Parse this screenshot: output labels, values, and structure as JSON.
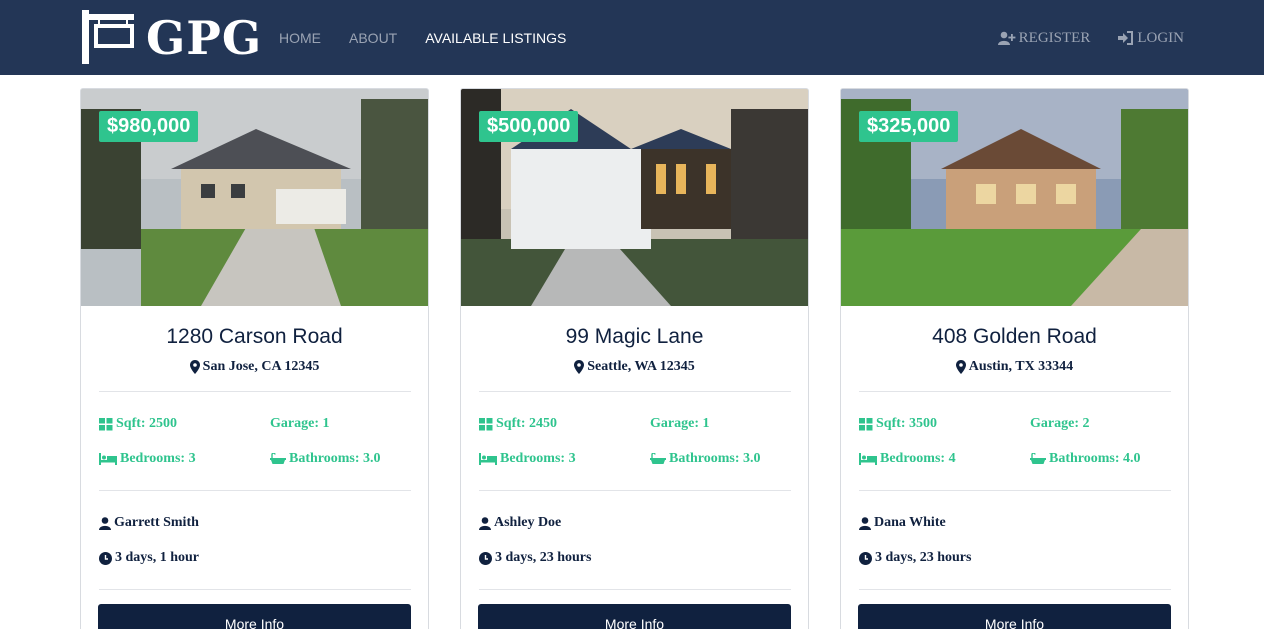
{
  "brand": {
    "logo_text": "GPG"
  },
  "nav": {
    "links": [
      {
        "label": "HOME"
      },
      {
        "label": "ABOUT"
      },
      {
        "label": "AVAILABLE LISTINGS"
      }
    ],
    "register_label": "REGISTER",
    "login_label": "LOGIN"
  },
  "colors": {
    "navbar": "#233656",
    "accent": "#2fc48e",
    "dark": "#10213f"
  },
  "listings": [
    {
      "price": "$980,000",
      "title": "1280 Carson Road",
      "location": "San Jose, CA 12345",
      "sqft": "Sqft: 2500",
      "garage": "Garage: 1",
      "bedrooms": "Bedrooms: 3",
      "bathrooms": "Bathrooms: 3.0",
      "realtor": "Garrett Smith",
      "listed": "3 days, 1 hour",
      "button": "More Info"
    },
    {
      "price": "$500,000",
      "title": "99 Magic Lane",
      "location": "Seattle, WA 12345",
      "sqft": "Sqft: 2450",
      "garage": "Garage: 1",
      "bedrooms": "Bedrooms: 3",
      "bathrooms": "Bathrooms: 3.0",
      "realtor": "Ashley Doe",
      "listed": "3 days, 23 hours",
      "button": "More Info"
    },
    {
      "price": "$325,000",
      "title": "408 Golden Road",
      "location": "Austin, TX 33344",
      "sqft": "Sqft: 3500",
      "garage": "Garage: 2",
      "bedrooms": "Bedrooms: 4",
      "bathrooms": "Bathrooms: 4.0",
      "realtor": "Dana White",
      "listed": "3 days, 23 hours",
      "button": "More Info"
    }
  ]
}
